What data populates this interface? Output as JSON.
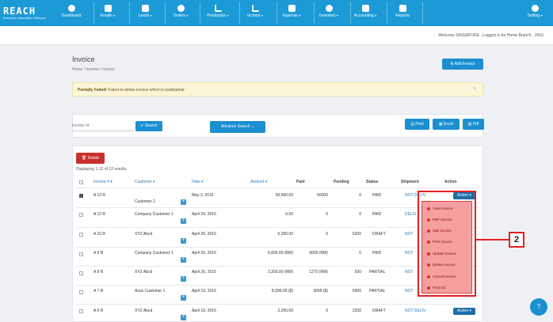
{
  "brand": {
    "name": "REACH",
    "tagline": "Business Automation Software"
  },
  "nav": [
    {
      "label": "Dashboard",
      "icon": "dashboard-icon",
      "caret": false
    },
    {
      "label": "Emails",
      "icon": "email-icon",
      "caret": true
    },
    {
      "label": "Leads",
      "icon": "leads-icon",
      "caret": true
    },
    {
      "label": "Orders",
      "icon": "orders-icon",
      "caret": true
    },
    {
      "label": "Production",
      "icon": "production-icon",
      "caret": true
    },
    {
      "label": "Income",
      "icon": "income-icon",
      "caret": true
    },
    {
      "label": "Expense",
      "icon": "expense-icon",
      "caret": true
    },
    {
      "label": "Inventory",
      "icon": "inventory-icon",
      "caret": true
    },
    {
      "label": "Accounting",
      "icon": "accounting-icon",
      "caret": true
    },
    {
      "label": "Reports",
      "icon": "reports-icon",
      "caret": false
    },
    {
      "label": "Setting",
      "icon": "gear-icon",
      "caret": true
    }
  ],
  "welcome": "Welcome SINGAPORE , Logged in for Home Branch - 2016",
  "page": {
    "title": "Invoice",
    "breadcrumb": "Home / Income / Invoice",
    "add_label": "Add Invoice"
  },
  "alert": {
    "strong": "Partially Failed!",
    "text": " Failed to delete invoice which is paid/partial",
    "close": "×"
  },
  "search": {
    "placeholder": "Invoice Id",
    "search_label": "Search",
    "advanced_label": "Advance Search",
    "print_label": "Print",
    "excel_label": "Excel",
    "pdf_label": "Pdf"
  },
  "table": {
    "delete_label": "Delete",
    "displaying": "Displaying 1-12 of 12 results.",
    "headers": {
      "invoice": "Invoice # ▾",
      "customer": "Customer ▾",
      "date": "Date ▾",
      "amount": "Amount ▾",
      "paid": "Paid",
      "pending": "Pending",
      "status": "Status",
      "shipment": "Shipment",
      "action": "Action"
    },
    "rows": [
      {
        "invoice": "A 13 R",
        "customer": "Customer 2",
        "date": "May 3, 2016",
        "amount": "50,600.00",
        "paid": "50000",
        "pending": "0",
        "status": "PAID",
        "shipment": "NOT DELIV",
        "checked": true,
        "action": "Action ▾"
      },
      {
        "invoice": "A 12 R",
        "customer": "Company Customer 1",
        "date": "April 24, 2016",
        "amount": "0.00",
        "paid": "0",
        "pending": "0",
        "status": "PAID",
        "shipment": "DELIV",
        "checked": false
      },
      {
        "invoice": "A 10 R",
        "customer": "XYZ Abcd",
        "date": "April 20, 2016",
        "amount": "5,200.00",
        "paid": "0",
        "pending": "5200",
        "status": "DRAFT",
        "shipment": "NOT",
        "checked": false
      },
      {
        "invoice": "A 9 R",
        "customer": "Company Customer 1",
        "date": "April 20, 2016",
        "amount": "6,600.00 (RM)",
        "paid": "6600 (RM)",
        "pending": "0",
        "status": "PAID",
        "shipment": "NOT",
        "checked": false
      },
      {
        "invoice": "A 8 R",
        "customer": "XYZ Abcd",
        "date": "April 20, 2016",
        "amount": "2,200.00 (RM)",
        "paid": "1270 (RM)",
        "pending": "930",
        "status": "PARTIAL",
        "shipment": "NOT",
        "checked": false
      },
      {
        "invoice": "A 7 R",
        "customer": "Asus Customer 1",
        "date": "April 19, 2016",
        "amount": "8,096.00 ($)",
        "paid": "3096 ($)",
        "pending": "5000",
        "status": "PARTIAL",
        "shipment": "NOT",
        "checked": false
      },
      {
        "invoice": "A 6 R",
        "customer": "XYZ Abcd",
        "date": "April 19, 2016",
        "amount": "2,200.00",
        "paid": "0",
        "pending": "2200",
        "status": "DRAFT",
        "shipment": "NOT DELIV",
        "checked": false,
        "action": "Action ▾"
      }
    ]
  },
  "action_menu": [
    "View Invoice",
    "PDF Invoice",
    "Mail Invoice",
    "Print Invoice",
    "Update Invoice",
    "Delete Invoice",
    "Cancel Invoice",
    "Print DC"
  ],
  "annotation": {
    "number": "2"
  },
  "colors": {
    "nav": "#1b9ad6",
    "primary": "#1b8fd0",
    "danger": "#c9302c",
    "annotation": "#e02020"
  }
}
